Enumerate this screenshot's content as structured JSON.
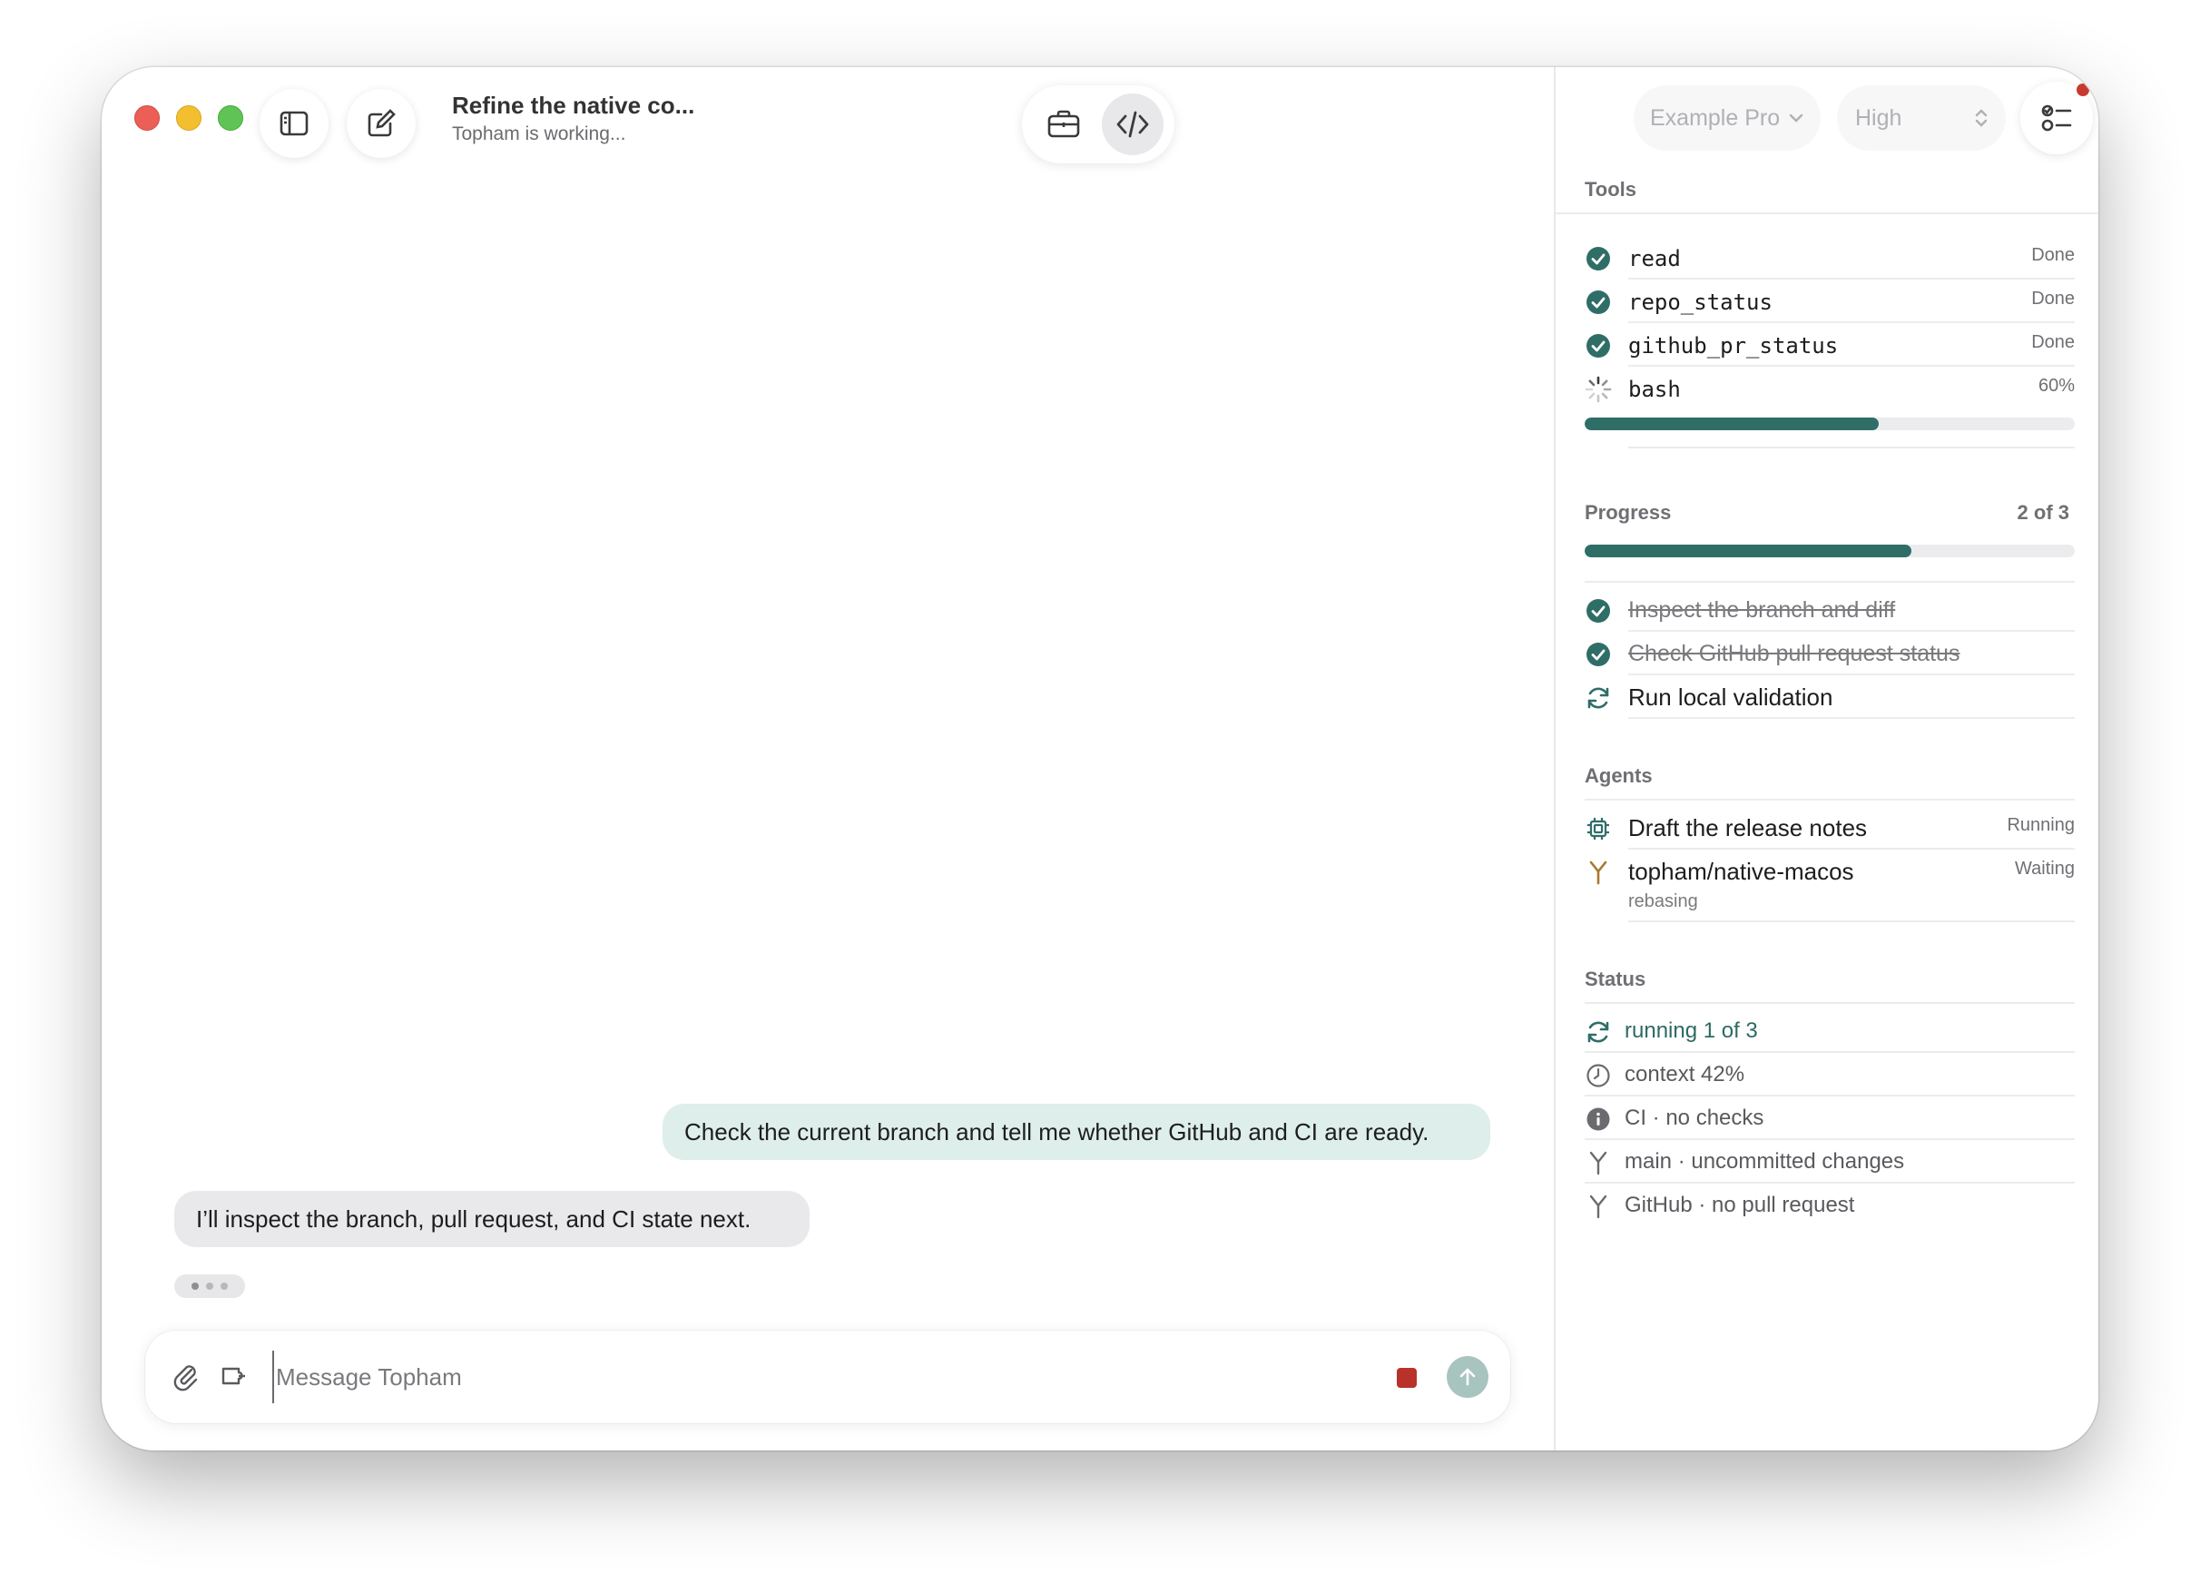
{
  "window": {
    "title": "Refine the native co...",
    "subtitle": "Topham is working..."
  },
  "toolbar": {
    "sidebar_toggle_icon": "sidebar-icon",
    "new_chat_icon": "compose-icon",
    "segments": [
      {
        "icon": "briefcase-icon",
        "selected": false
      },
      {
        "icon": "code-icon",
        "selected": true
      }
    ]
  },
  "chat": {
    "user_message": "Check the current branch and tell me whether GitHub and CI are ready.",
    "assistant_message": "I’ll inspect the branch, pull request, and CI state next."
  },
  "composer": {
    "placeholder": "Message Topham",
    "value": ""
  },
  "sidebar": {
    "model": "Example Pro",
    "effort": "High",
    "tools": {
      "heading": "Tools",
      "items": [
        {
          "name": "read",
          "status": "Done"
        },
        {
          "name": "repo_status",
          "status": "Done"
        },
        {
          "name": "github_pr_status",
          "status": "Done"
        },
        {
          "name": "bash",
          "status": "60%"
        }
      ],
      "bash_progress": 0.6
    },
    "progress": {
      "heading": "Progress",
      "count": "2 of 3",
      "fraction": 0.667,
      "steps": [
        {
          "label": "Inspect the branch and diff",
          "done": true
        },
        {
          "label": "Check GitHub pull request status",
          "done": true
        },
        {
          "label": "Run local validation",
          "done": false
        }
      ]
    },
    "agents": {
      "heading": "Agents",
      "items": [
        {
          "name": "Draft the release notes",
          "status": "Running",
          "detail": ""
        },
        {
          "name": "topham/native-macos",
          "status": "Waiting",
          "detail": "rebasing"
        }
      ]
    },
    "status": {
      "heading": "Status",
      "items": [
        {
          "label": "running 1 of 3"
        },
        {
          "label": "context 42%"
        },
        {
          "label": "CI · no checks"
        },
        {
          "label": "main · uncommitted changes"
        },
        {
          "label": "GitHub · no pull request"
        }
      ]
    }
  },
  "colors": {
    "accent": "#2f6e67",
    "user_bubble": "#deeeea",
    "assistant_bubble": "#e9e9eb",
    "stop": "#b8322a",
    "send": "#a7c4be",
    "agent_branch": "#a8782e"
  }
}
